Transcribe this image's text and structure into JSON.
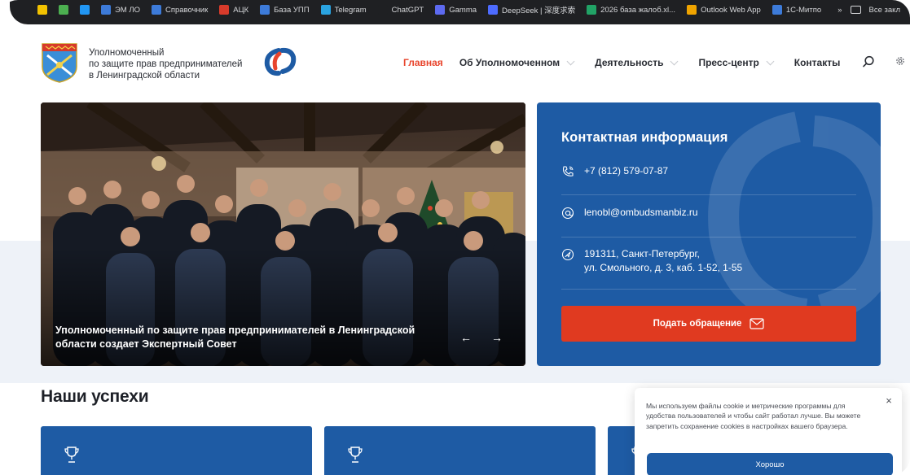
{
  "bookmarks": {
    "items": [
      {
        "label": "",
        "color": "#f2c200"
      },
      {
        "label": "",
        "color": "#4caf50"
      },
      {
        "label": "",
        "color": "#2196f3"
      },
      {
        "label": "ЭМ ЛО",
        "color": "#3d7bd9"
      },
      {
        "label": "Справочник",
        "color": "#3d7bd9"
      },
      {
        "label": "АЦК",
        "color": "#d83b2b"
      },
      {
        "label": "База УПП",
        "color": "#3d7bd9"
      },
      {
        "label": "Telegram",
        "color": "#2aa3e0"
      },
      {
        "label": "ChatGPT",
        "color": "#1f2023"
      },
      {
        "label": "Gamma",
        "color": "#5d6af0"
      },
      {
        "label": "DeepSeek | 深度求索",
        "color": "#4d6bfe"
      },
      {
        "label": "2026 база жалоб.xl...",
        "color": "#21a366"
      },
      {
        "label": "Outlook Web App",
        "color": "#f0a400"
      },
      {
        "label": "1С-Митпо",
        "color": "#3d7bd9"
      }
    ],
    "overflow": "»",
    "all_bookmarks": "Все закл"
  },
  "header": {
    "org_name_lines": [
      "Уполномоченный",
      "по защите прав предпринимателей",
      "в Ленинградской области"
    ],
    "nav": [
      {
        "label": "Главная",
        "active": true,
        "has_dropdown": false
      },
      {
        "label": "Об Уполномоченном",
        "active": false,
        "has_dropdown": true
      },
      {
        "label": "Деятельность",
        "active": false,
        "has_dropdown": true
      },
      {
        "label": "Пресс-центр",
        "active": false,
        "has_dropdown": true
      },
      {
        "label": "Контакты",
        "active": false,
        "has_dropdown": false
      }
    ]
  },
  "hero": {
    "caption": "Уполномоченный по защите прав предпринимателей в Ленинградской области создает Экспертный Совет",
    "prev": "←",
    "next": "→"
  },
  "contact": {
    "title": "Контактная информация",
    "phone": "+7 (812) 579-07-87",
    "email": "lenobl@ombudsmanbiz.ru",
    "address_line1": "191311, Санкт-Петербург,",
    "address_line2": "ул. Смольного, д. 3, каб. 1-52, 1-55",
    "cta_label": "Подать обращение"
  },
  "successes": {
    "title": "Наши успехи"
  },
  "cookie": {
    "text": "Мы используем файлы cookie и метрические программы для удобства пользователей и чтобы сайт работал лучше. Вы можете запретить сохранение cookies в настройках вашего браузера.",
    "close": "×",
    "button": "Хорошо"
  },
  "colors": {
    "accent_red": "#e8452d",
    "brand_blue": "#1e5ba4",
    "cta_red": "#e03a20"
  }
}
